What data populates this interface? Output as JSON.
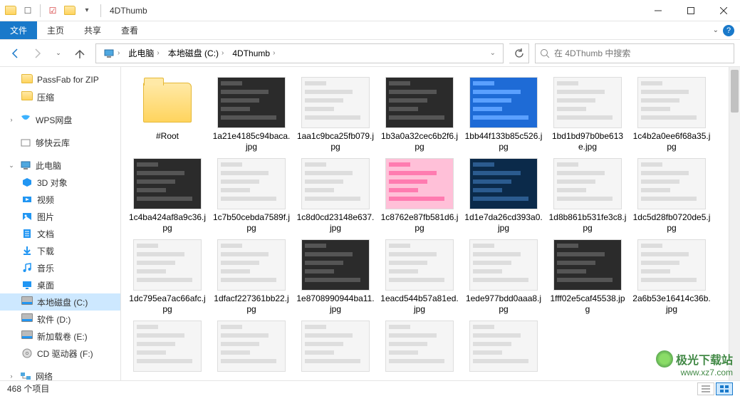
{
  "window": {
    "title": "4DThumb"
  },
  "ribbon": {
    "tabs": [
      "文件",
      "主页",
      "共享",
      "查看"
    ],
    "active": 0
  },
  "nav": {
    "breadcrumbs": [
      "此电脑",
      "本地磁盘 (C:)",
      "4DThumb"
    ],
    "search_placeholder": "在 4DThumb 中搜索"
  },
  "sidebar": {
    "items": [
      {
        "label": "PassFab for ZIP",
        "icon": "folder",
        "indent": 1
      },
      {
        "label": "压缩",
        "icon": "folder",
        "indent": 1
      },
      {
        "label": "",
        "icon": "spacer",
        "indent": 0
      },
      {
        "label": "WPS网盘",
        "icon": "wps",
        "indent": 0,
        "expandable": true
      },
      {
        "label": "",
        "icon": "spacer",
        "indent": 0
      },
      {
        "label": "够快云库",
        "icon": "cloud",
        "indent": 0
      },
      {
        "label": "",
        "icon": "spacer",
        "indent": 0
      },
      {
        "label": "此电脑",
        "icon": "pc",
        "indent": 0,
        "expandable": true,
        "expanded": true
      },
      {
        "label": "3D 对象",
        "icon": "3d",
        "indent": 1
      },
      {
        "label": "视频",
        "icon": "video",
        "indent": 1
      },
      {
        "label": "图片",
        "icon": "picture",
        "indent": 1
      },
      {
        "label": "文档",
        "icon": "doc",
        "indent": 1
      },
      {
        "label": "下载",
        "icon": "download",
        "indent": 1
      },
      {
        "label": "音乐",
        "icon": "music",
        "indent": 1
      },
      {
        "label": "桌面",
        "icon": "desktop",
        "indent": 1
      },
      {
        "label": "本地磁盘 (C:)",
        "icon": "disk",
        "indent": 1,
        "selected": true
      },
      {
        "label": "软件 (D:)",
        "icon": "disk",
        "indent": 1
      },
      {
        "label": "新加载卷 (E:)",
        "icon": "disk",
        "indent": 1
      },
      {
        "label": "CD 驱动器 (F:)",
        "icon": "cd",
        "indent": 1
      },
      {
        "label": "",
        "icon": "spacer",
        "indent": 0
      },
      {
        "label": "网络",
        "icon": "network",
        "indent": 0,
        "expandable": true
      }
    ]
  },
  "files": [
    {
      "name": "#Root",
      "type": "folder"
    },
    {
      "name": "1a21e4185c94baca.jpg",
      "type": "jpg",
      "theme": "dark"
    },
    {
      "name": "1aa1c9bca25fb079.jpg",
      "type": "jpg",
      "theme": "light"
    },
    {
      "name": "1b3a0a32cec6b2f6.jpg",
      "type": "jpg",
      "theme": "dark"
    },
    {
      "name": "1bb44f133b85c526.jpg",
      "type": "jpg",
      "theme": "blue"
    },
    {
      "name": "1bd1bd97b0be613e.jpg",
      "type": "jpg",
      "theme": "light"
    },
    {
      "name": "1c4b2a0ee6f68a35.jpg",
      "type": "jpg",
      "theme": "light"
    },
    {
      "name": "1c4ba424af8a9c36.jpg",
      "type": "jpg",
      "theme": "dark"
    },
    {
      "name": "1c7b50cebda7589f.jpg",
      "type": "jpg",
      "theme": "light"
    },
    {
      "name": "1c8d0cd23148e637.jpg",
      "type": "jpg",
      "theme": "light"
    },
    {
      "name": "1c8762e87fb581d6.jpg",
      "type": "jpg",
      "theme": "pink"
    },
    {
      "name": "1d1e7da26cd393a0.jpg",
      "type": "jpg",
      "theme": "darkblue"
    },
    {
      "name": "1d8b861b531fe3c8.jpg",
      "type": "jpg",
      "theme": "light"
    },
    {
      "name": "1dc5d28fb0720de5.jpg",
      "type": "jpg",
      "theme": "light"
    },
    {
      "name": "1dc795ea7ac66afc.jpg",
      "type": "jpg",
      "theme": "light"
    },
    {
      "name": "1dfacf227361bb22.jpg",
      "type": "jpg",
      "theme": "light"
    },
    {
      "name": "1e8708990944ba11.jpg",
      "type": "jpg",
      "theme": "dark"
    },
    {
      "name": "1eacd544b57a81ed.jpg",
      "type": "jpg",
      "theme": "light"
    },
    {
      "name": "1ede977bdd0aaa8.jpg",
      "type": "jpg",
      "theme": "light"
    },
    {
      "name": "1fff02e5caf45538.jpg",
      "type": "jpg",
      "theme": "dark"
    },
    {
      "name": "2a6b53e16414c36b.jpg",
      "type": "jpg",
      "theme": "light"
    },
    {
      "name": "",
      "type": "jpg",
      "theme": "light",
      "partial": true
    },
    {
      "name": "",
      "type": "jpg",
      "theme": "light",
      "partial": true
    },
    {
      "name": "",
      "type": "jpg",
      "theme": "light",
      "partial": true
    },
    {
      "name": "",
      "type": "jpg",
      "theme": "light",
      "partial": true
    },
    {
      "name": "",
      "type": "jpg",
      "theme": "light",
      "partial": true
    }
  ],
  "status": {
    "count_label": "468 个项目"
  },
  "watermark": {
    "brand": "极光下载站",
    "url": "www.xz7.com"
  }
}
